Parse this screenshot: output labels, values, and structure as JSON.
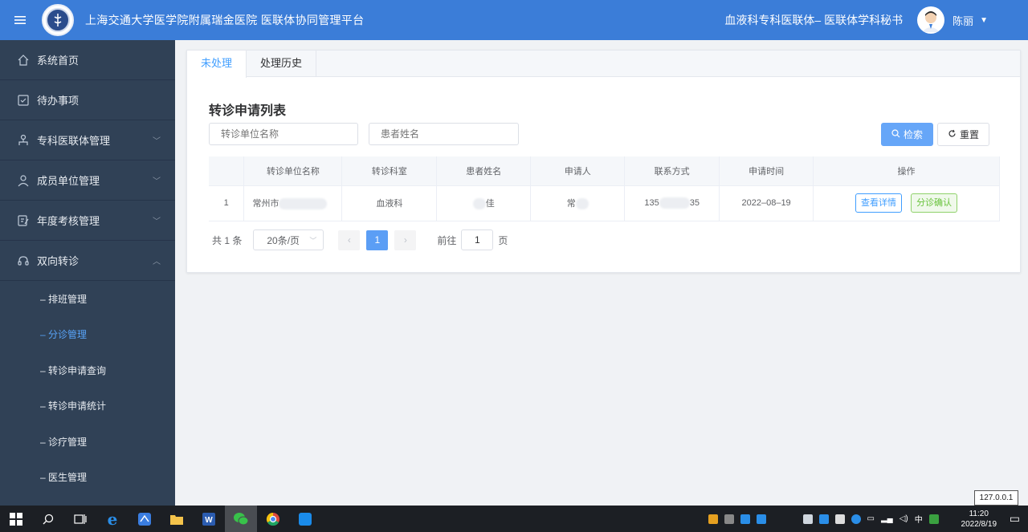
{
  "header": {
    "app_title": "上海交通大学医学院附属瑞金医院 医联体协同管理平台",
    "org_title": "血液科专科医联体– 医联体学科秘书",
    "user_name": "陈丽"
  },
  "sidebar": {
    "items": [
      {
        "label": "系统首页",
        "icon": "home-icon"
      },
      {
        "label": "待办事项",
        "icon": "checklist-icon"
      },
      {
        "label": "专科医联体管理",
        "icon": "hierarchy-icon",
        "expandable": true
      },
      {
        "label": "成员单位管理",
        "icon": "user-icon",
        "expandable": true
      },
      {
        "label": "年度考核管理",
        "icon": "edit-doc-icon",
        "expandable": true
      },
      {
        "label": "双向转诊",
        "icon": "headset-icon",
        "expandable": true,
        "expanded": true
      }
    ],
    "sub_items": [
      {
        "label": "– 排班管理",
        "active": false
      },
      {
        "label": "– 分诊管理",
        "active": true
      },
      {
        "label": "– 转诊申请查询",
        "active": false
      },
      {
        "label": "– 转诊申请统计",
        "active": false
      },
      {
        "label": "– 诊疗管理",
        "active": false
      },
      {
        "label": "– 医生管理",
        "active": false
      }
    ]
  },
  "tabs": [
    {
      "label": "未处理",
      "active": true
    },
    {
      "label": "处理历史",
      "active": false
    }
  ],
  "main": {
    "list_title": "转诊申请列表",
    "filter_unit_placeholder": "转诊单位名称",
    "filter_patient_placeholder": "患者姓名",
    "search_label": "检索",
    "reset_label": "重置"
  },
  "table": {
    "columns": [
      "",
      "转诊单位名称",
      "转诊科室",
      "患者姓名",
      "申请人",
      "联系方式",
      "申请时间",
      "操作"
    ],
    "rows": [
      {
        "index": "1",
        "unit": "常州市",
        "dept": "血液科",
        "patient": "佳",
        "applicant": "常",
        "phone_prefix": "135",
        "phone_suffix": "35",
        "date": "2022–08–19",
        "detail_label": "查看详情",
        "confirm_label": "分诊确认"
      }
    ]
  },
  "pager": {
    "total": "共 1 条",
    "page_size": "20条/页",
    "current_page": "1",
    "goto_prefix": "前往",
    "goto_value": "1",
    "goto_suffix": "页"
  },
  "ip_badge": "127.0.0.1",
  "taskbar": {
    "time": "11:20",
    "date": "2022/8/19"
  },
  "colors": {
    "header_bg": "#3b7dd8",
    "sidebar_bg": "#304156",
    "accent": "#409eff",
    "success": "#67c23a"
  }
}
